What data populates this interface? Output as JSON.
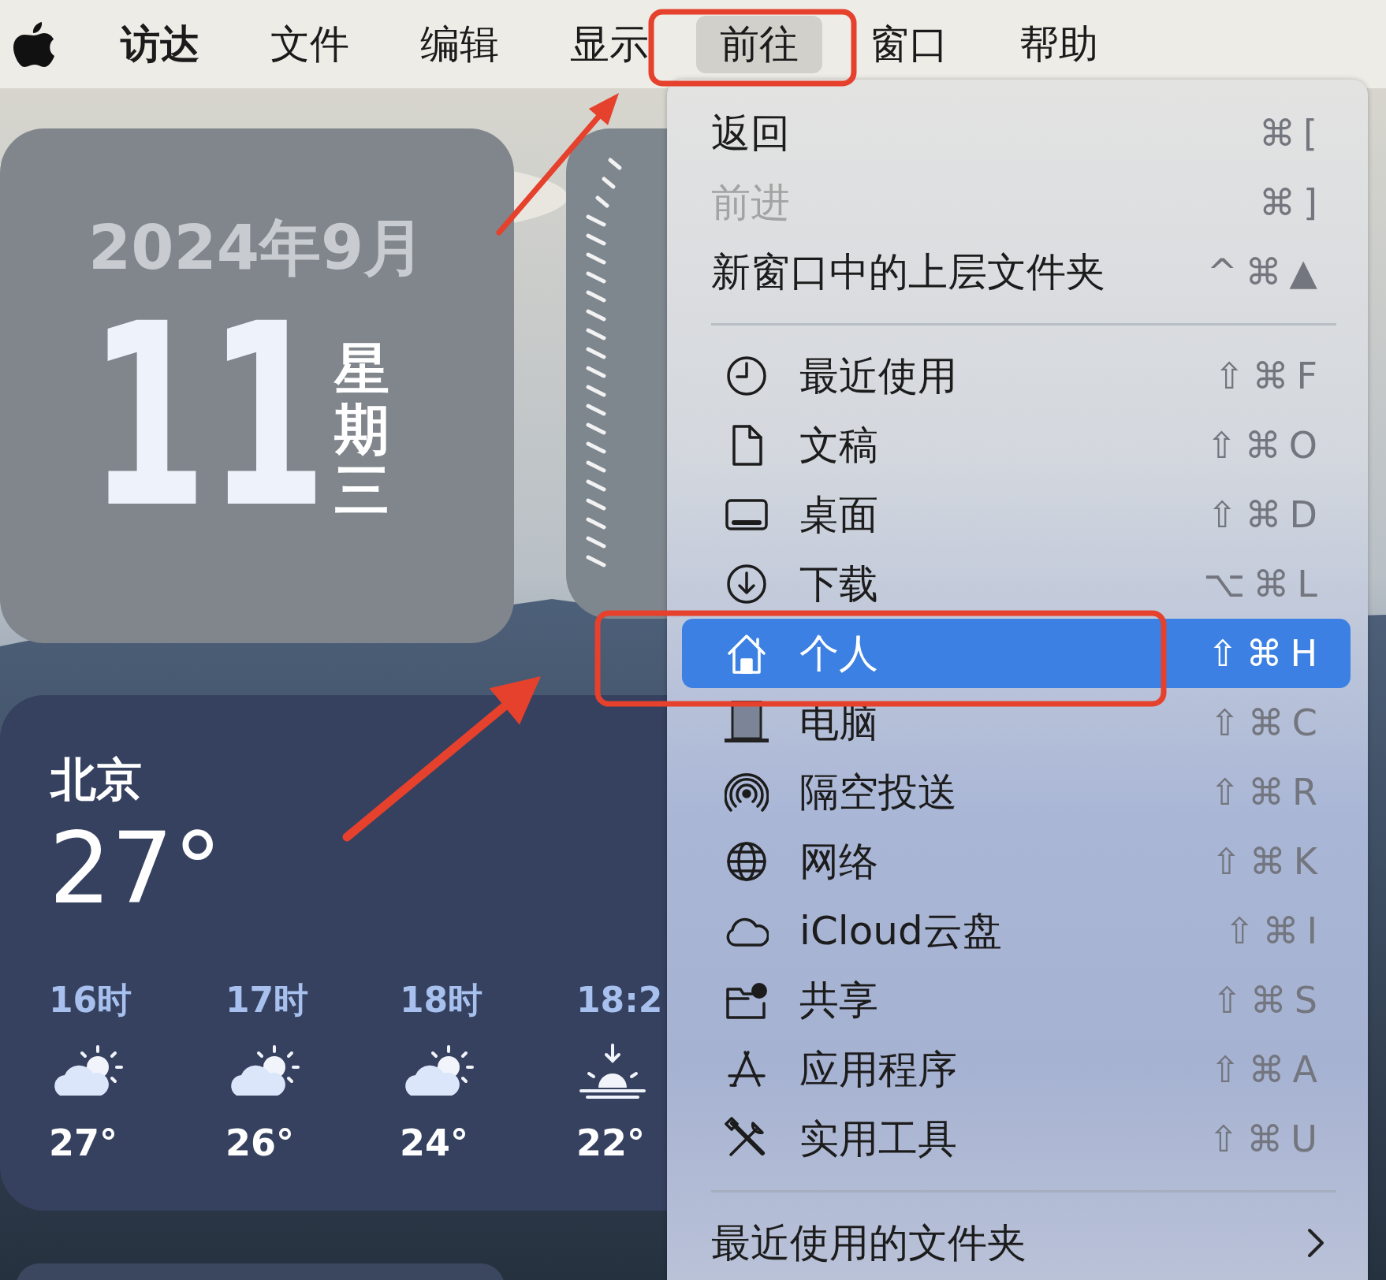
{
  "menu_bar": {
    "items": [
      {
        "label": "访达",
        "bold": true,
        "selected": false
      },
      {
        "label": "文件",
        "bold": false,
        "selected": false
      },
      {
        "label": "编辑",
        "bold": false,
        "selected": false
      },
      {
        "label": "显示",
        "bold": false,
        "selected": false
      },
      {
        "label": "前往",
        "bold": false,
        "selected": true
      },
      {
        "label": "窗口",
        "bold": false,
        "selected": false
      },
      {
        "label": "帮助",
        "bold": false,
        "selected": false
      }
    ]
  },
  "calendar_widget": {
    "month": "2024年9月",
    "day": "11",
    "weekday": "星期三"
  },
  "weather_widget": {
    "city": "北京",
    "temperature": "27°",
    "forecast": [
      {
        "time": "16时",
        "kind": "partly-cloudy",
        "temperature": "27°"
      },
      {
        "time": "17时",
        "kind": "partly-cloudy",
        "temperature": "26°"
      },
      {
        "time": "18时",
        "kind": "partly-cloudy",
        "temperature": "24°"
      },
      {
        "time": "18:2",
        "kind": "sunset",
        "temperature": "22°"
      }
    ]
  },
  "menu": {
    "items": [
      {
        "kind": "item",
        "label": "返回",
        "shortcut": "⌘[",
        "disabled": false,
        "selected": false
      },
      {
        "kind": "item",
        "label": "前进",
        "shortcut": "⌘]",
        "disabled": true,
        "selected": false
      },
      {
        "kind": "item",
        "label": "新窗口中的上层文件夹",
        "shortcut": "^⌘▲",
        "disabled": false,
        "selected": false
      },
      {
        "kind": "separator"
      },
      {
        "kind": "item",
        "label": "最近使用",
        "shortcut": "⇧⌘F",
        "disabled": false,
        "selected": false
      },
      {
        "kind": "item",
        "label": "文稿",
        "shortcut": "⇧⌘O",
        "disabled": false,
        "selected": false
      },
      {
        "kind": "item",
        "label": "桌面",
        "shortcut": "⇧⌘D",
        "disabled": false,
        "selected": false
      },
      {
        "kind": "item",
        "label": "下载",
        "shortcut": "⌥⌘L",
        "disabled": false,
        "selected": false
      },
      {
        "kind": "item",
        "label": "个人",
        "shortcut": "⇧⌘H",
        "disabled": false,
        "selected": true
      },
      {
        "kind": "item",
        "label": "电脑",
        "shortcut": "⇧⌘C",
        "disabled": false,
        "selected": false
      },
      {
        "kind": "item",
        "label": "隔空投送",
        "shortcut": "⇧⌘R",
        "disabled": false,
        "selected": false
      },
      {
        "kind": "item",
        "label": "网络",
        "shortcut": "⇧⌘K",
        "disabled": false,
        "selected": false
      },
      {
        "kind": "item",
        "label": "iCloud云盘",
        "shortcut": "⇧⌘I",
        "disabled": false,
        "selected": false
      },
      {
        "kind": "item",
        "label": "共享",
        "shortcut": "⇧⌘S",
        "disabled": false,
        "selected": false
      },
      {
        "kind": "item",
        "label": "应用程序",
        "shortcut": "⇧⌘A",
        "disabled": false,
        "selected": false
      },
      {
        "kind": "item",
        "label": "实用工具",
        "shortcut": "⇧⌘U",
        "disabled": false,
        "selected": false
      },
      {
        "kind": "separator"
      },
      {
        "kind": "submenu",
        "label": "最近使用的文件夹",
        "disabled": false,
        "selected": false
      }
    ]
  },
  "annotations": [
    {
      "kind": "box"
    },
    {
      "kind": "box"
    },
    {
      "kind": "arrow"
    },
    {
      "kind": "arrow"
    }
  ]
}
